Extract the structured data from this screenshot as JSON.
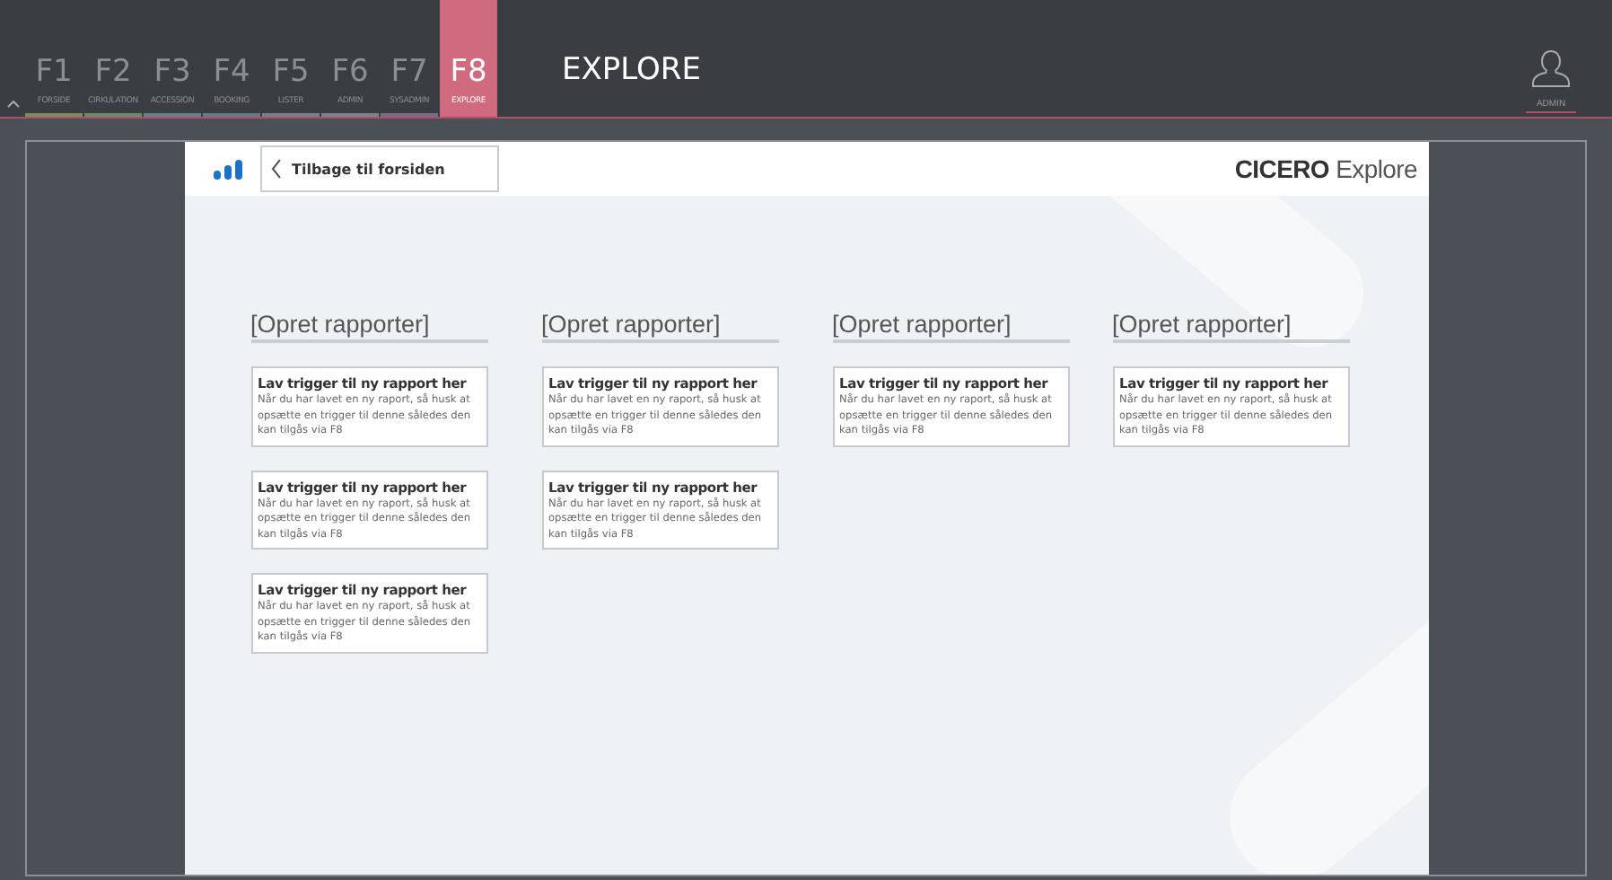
{
  "function_keys": [
    {
      "key": "F1",
      "label": "FORSIDE",
      "color": "#7d8a5c",
      "selected": false
    },
    {
      "key": "F2",
      "label": "CIRKULATION",
      "color": "#6f8a6a",
      "selected": false
    },
    {
      "key": "F3",
      "label": "ACCESSION",
      "color": "#6a8088",
      "selected": false
    },
    {
      "key": "F4",
      "label": "BOOKING",
      "color": "#6a7a88",
      "selected": false
    },
    {
      "key": "F5",
      "label": "LISTER",
      "color": "#7a8088",
      "selected": false
    },
    {
      "key": "F6",
      "label": "ADMIN",
      "color": "#80808a",
      "selected": false
    },
    {
      "key": "F7",
      "label": "SYSADMIN",
      "color": "#7a6a88",
      "selected": false
    },
    {
      "key": "F8",
      "label": "EXPLORE",
      "color": "#d06a7f",
      "selected": true
    }
  ],
  "page_title": "EXPLORE",
  "user": {
    "label": "ADMIN"
  },
  "header": {
    "back_button": "Tilbage til forsiden",
    "logo_bold": "CICERO",
    "logo_light": "Explore"
  },
  "columns": [
    {
      "heading": "[Opret rapporter]",
      "cards": [
        {
          "title": "Lav trigger til ny rapport her",
          "text": "Når du har lavet en ny raport, så husk at opsætte en trigger til denne således den kan tilgås via F8"
        },
        {
          "title": "Lav trigger til ny rapport her",
          "text": "Når du har lavet en ny raport, så husk at opsætte en trigger til denne således den kan tilgås via F8"
        },
        {
          "title": "Lav trigger til ny rapport her",
          "text": "Når du har lavet en ny raport, så husk at opsætte en trigger til denne således den kan tilgås via F8"
        }
      ]
    },
    {
      "heading": "[Opret rapporter]",
      "cards": [
        {
          "title": "Lav trigger til ny rapport her",
          "text": "Når du har lavet en ny raport, så husk at opsætte en trigger til denne således den kan tilgås via F8"
        },
        {
          "title": "Lav trigger til ny rapport her",
          "text": "Når du har lavet en ny raport, så husk at opsætte en trigger til denne således den kan tilgås via F8"
        }
      ]
    },
    {
      "heading": "[Opret rapporter]",
      "cards": [
        {
          "title": "Lav trigger til ny rapport her",
          "text": "Når du har lavet en ny raport, så husk at opsætte en trigger til denne således den kan tilgås via F8"
        }
      ]
    },
    {
      "heading": "[Opret rapporter]",
      "cards": [
        {
          "title": "Lav trigger til ny rapport her",
          "text": "Når du har lavet en ny raport, så husk at opsætte en trigger til denne således den kan tilgås via F8"
        }
      ]
    }
  ]
}
